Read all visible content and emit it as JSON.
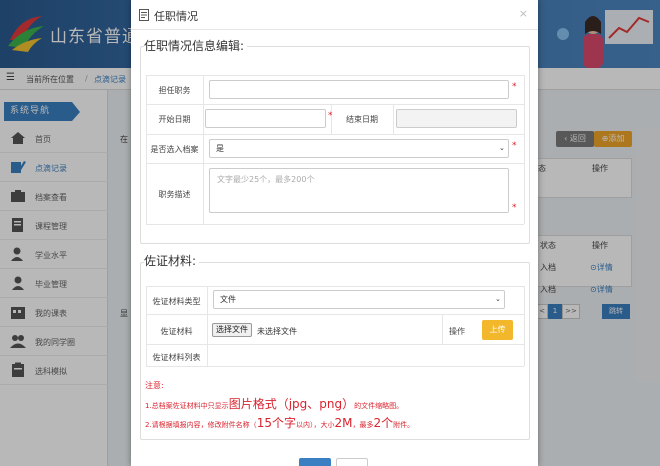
{
  "app": {
    "title": "山东省普通",
    "breadcrumb": {
      "location_label": "当前所在位置",
      "separator": "/",
      "current": "点滴记录"
    }
  },
  "sidebar": {
    "heading": "系统导航",
    "items": [
      {
        "label": "首页",
        "icon": "home-icon"
      },
      {
        "label": "点滴记录",
        "icon": "edit-icon",
        "active": true
      },
      {
        "label": "档案查看",
        "icon": "archive-icon"
      },
      {
        "label": "课程管理",
        "icon": "course-icon"
      },
      {
        "label": "学业水平",
        "icon": "user-icon"
      },
      {
        "label": "毕业管理",
        "icon": "graduate-icon"
      },
      {
        "label": "我的课表",
        "icon": "schedule-icon"
      },
      {
        "label": "我的同学圈",
        "icon": "group-icon"
      },
      {
        "label": "选科模拟",
        "icon": "clipboard-icon"
      }
    ]
  },
  "background": {
    "back_button": "‹ 返回",
    "add_button": "⊕添加",
    "partial_left_1": "在",
    "partial_left_2": "显",
    "table1_headers": [
      "态",
      "操作"
    ],
    "table2_headers": [
      "状态",
      "操作"
    ],
    "table2_rows": [
      {
        "status": "入档",
        "action": "⊙详情"
      },
      {
        "status": "入档",
        "action": "⊙详情"
      }
    ],
    "pager": {
      "prev": "<",
      "page": "1",
      "next": ">>",
      "jump": "跳转"
    }
  },
  "modal": {
    "title": "任职情况",
    "close": "×",
    "section1": {
      "legend": "任职情况信息编辑:",
      "position_label": "担任职务",
      "position_value": "",
      "start_date_label": "开始日期",
      "start_date_value": "",
      "end_date_label": "结束日期",
      "end_date_value": "",
      "archive_label": "是否选入档案",
      "archive_value": "是",
      "desc_label": "职务描述",
      "desc_placeholder": "文字最少25个，最多200个",
      "required_mark": "*"
    },
    "section2": {
      "legend": "佐证材料:",
      "type_label": "佐证材料类型",
      "type_value": "文件",
      "material_label": "佐证材料",
      "choose_file": "选择文件",
      "no_file": "未选择文件",
      "operation_label": "操作",
      "upload_button": "上传",
      "list_label": "佐证材料列表"
    },
    "notes": {
      "heading": "注意:",
      "line1_prefix": "1.总档案佐证材料中只显示",
      "line1_big": "图片格式（jpg、png）",
      "line1_suffix": "的文件缩略图。",
      "line2_prefix": "2.请根据填报内容，修改附件名称（",
      "line2_big1": "15个字",
      "line2_mid": "以内），大小",
      "line2_big2": "2M",
      "line2_mid2": "，最多",
      "line2_big3": "2个",
      "line2_suffix": "附件。"
    }
  },
  "colors": {
    "primary": "#3a7fc1",
    "required": "#d9232e",
    "upload": "#f2b72a",
    "back_button": "#7a7a7a",
    "add_button": "#f0a52a"
  }
}
